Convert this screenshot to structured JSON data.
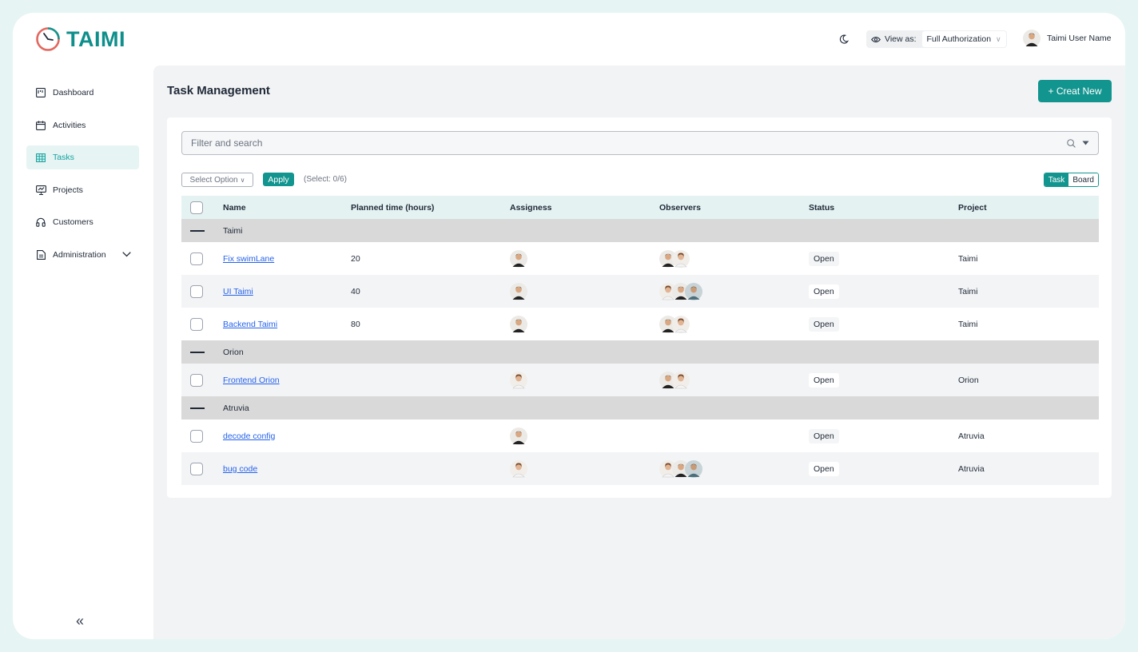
{
  "app": {
    "logo_text": "TAIMI"
  },
  "header": {
    "view_as_label": "View as:",
    "view_as_value": "Full Authorization",
    "user_name": "Taimi User Name"
  },
  "sidebar": {
    "items": [
      {
        "label": "Dashboard",
        "icon": "dashboard-icon"
      },
      {
        "label": "Activities",
        "icon": "calendar-icon"
      },
      {
        "label": "Tasks",
        "icon": "table-icon",
        "active": true
      },
      {
        "label": "Projects",
        "icon": "presentation-icon"
      },
      {
        "label": "Customers",
        "icon": "headset-icon"
      },
      {
        "label": "Administration",
        "icon": "document-icon"
      }
    ],
    "collapse_glyph": "«"
  },
  "main": {
    "title": "Task Management",
    "create_button": "+ Creat New",
    "search_placeholder": "Filter and search",
    "select_option": "Select Option",
    "apply": "Apply",
    "select_count": "(Select: 0/6)",
    "toggle": {
      "task": "Task",
      "board": "Board",
      "active": "Task"
    }
  },
  "table": {
    "headers": [
      "Name",
      "Planned time (hours)",
      "Assigness",
      "Observers",
      "Status",
      "Project"
    ],
    "groups": [
      {
        "name": "Taimi",
        "rows": [
          {
            "name": "Fix swimLane",
            "planned": "20",
            "assignees": [
              "man"
            ],
            "observers": [
              "man",
              "woman"
            ],
            "status": "Open",
            "project": "Taimi"
          },
          {
            "name": "UI Taimi",
            "planned": "40",
            "assignees": [
              "man"
            ],
            "observers": [
              "woman",
              "man",
              "man2"
            ],
            "status": "Open",
            "project": "Taimi"
          },
          {
            "name": "Backend Taimi",
            "planned": "80",
            "assignees": [
              "man"
            ],
            "observers": [
              "man",
              "woman"
            ],
            "status": "Open",
            "project": "Taimi"
          }
        ]
      },
      {
        "name": "Orion",
        "rows": [
          {
            "name": "Frontend Orion",
            "planned": "",
            "assignees": [
              "woman"
            ],
            "observers": [
              "man",
              "woman"
            ],
            "status": "Open",
            "project": "Orion"
          }
        ]
      },
      {
        "name": "Atruvia",
        "rows": [
          {
            "name": "decode config",
            "planned": "",
            "assignees": [
              "man"
            ],
            "observers": [],
            "status": "Open",
            "project": "Atruvia"
          },
          {
            "name": "bug code",
            "planned": "",
            "assignees": [
              "woman"
            ],
            "observers": [
              "woman",
              "man",
              "man2"
            ],
            "status": "Open",
            "project": "Atruvia"
          }
        ]
      }
    ]
  },
  "colors": {
    "accent": "#13958f",
    "active_bg": "#e6f4f4",
    "link": "#2563eb",
    "group_bg": "#d9d9d9"
  }
}
